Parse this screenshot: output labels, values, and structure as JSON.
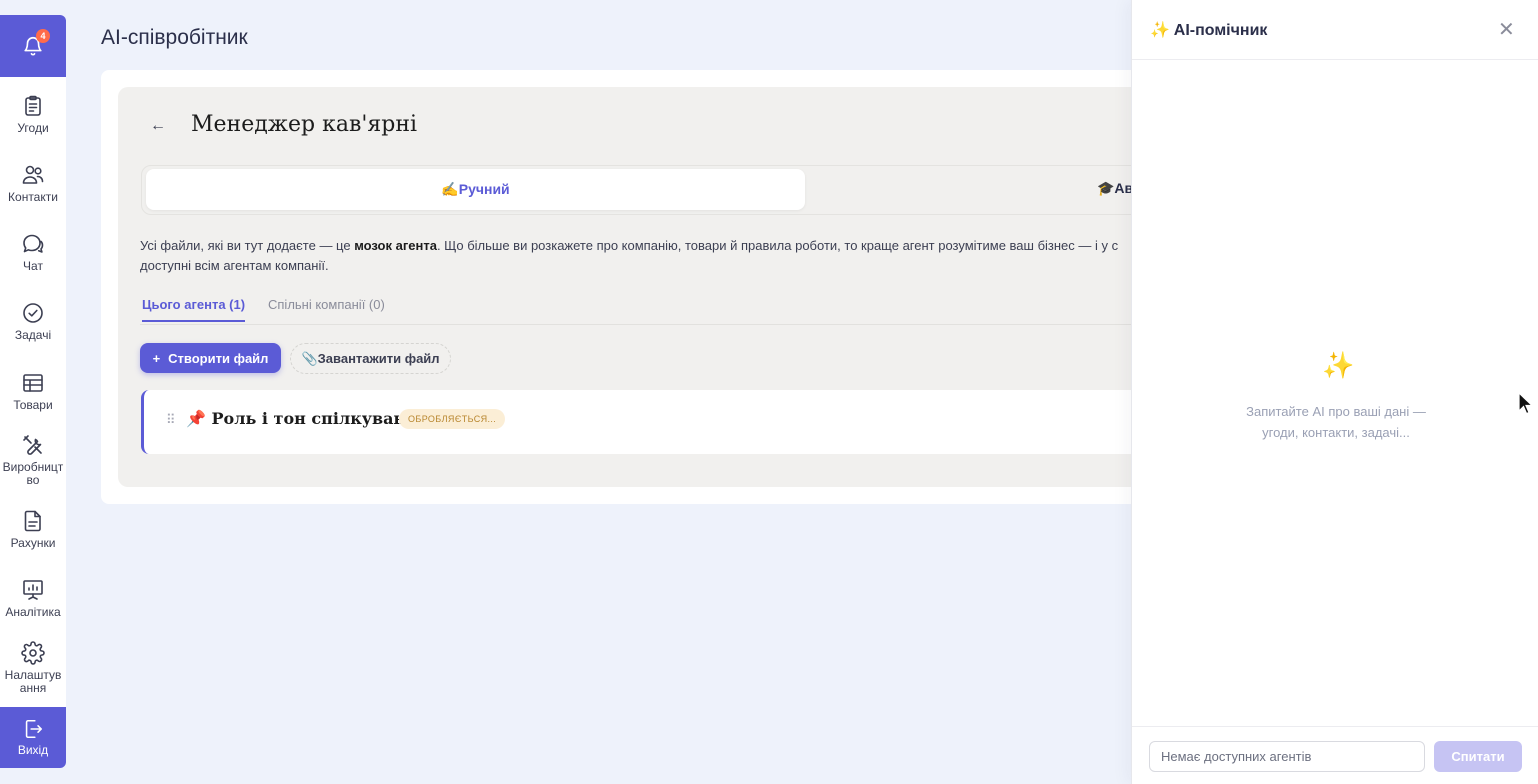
{
  "sidebar": {
    "notifications": {
      "count": "4"
    },
    "items": [
      {
        "label": "Угоди",
        "icon": "clipboard-icon"
      },
      {
        "label": "Контакти",
        "icon": "users-icon"
      },
      {
        "label": "Чат",
        "icon": "chat-icon"
      },
      {
        "label": "Задачі",
        "icon": "check-circle-icon"
      },
      {
        "label": "Товари",
        "icon": "table-icon"
      },
      {
        "label": "Виробництво",
        "icon": "tools-icon"
      },
      {
        "label": "Рахунки",
        "icon": "document-icon"
      },
      {
        "label": "Аналітика",
        "icon": "presentation-chart-icon"
      },
      {
        "label": "Налаштування",
        "icon": "gear-icon"
      }
    ],
    "logout_label": "Вихід"
  },
  "page": {
    "title": "AI-співробітник",
    "agent_title": "Менеджер кав'ярні",
    "back_symbol": "←",
    "modes": {
      "active_label": "✍️Ручний",
      "other_label": "🎓Ав"
    },
    "description": {
      "part1": "Усі файли, які ви тут додаєте — це ",
      "bold": "мозок агента",
      "part2": ". Що більше ви розкажете про компанію, товари й правила роботи, то краще агент розумітиме ваш бізнес — і у с",
      "line2": "доступні всім агентам компанії."
    },
    "subtabs": [
      {
        "label": "Цього агента (1)"
      },
      {
        "label": "Спільні компанії (0)"
      }
    ],
    "create_button": "Створити файл",
    "create_button_icon": "+",
    "upload_button": "📎Завантажити файл",
    "files": [
      {
        "name": "📌 Роль і тон спілкування",
        "status": "ОБРОБЛЯЄТЬСЯ..."
      }
    ]
  },
  "assistant": {
    "title": "✨ AI-помічник",
    "close_symbol": "✕",
    "empty_icon": "✨",
    "empty_line1": "Запитайте AI про ваші дані —",
    "empty_line2": "угоди, контакти, задачі...",
    "input_placeholder": "Немає доступних агентів",
    "ask_button": "Спитати"
  },
  "colors": {
    "accent": "#5b5bd6",
    "background": "#eef2fb",
    "badge": "#ff6b4a",
    "status_bg": "#fbeed6",
    "status_text": "#b8862e"
  }
}
